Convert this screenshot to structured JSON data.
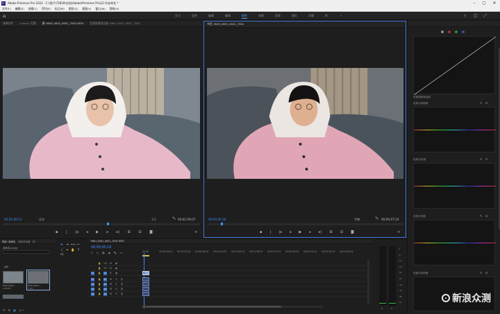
{
  "titlebar": {
    "title": "Adobe Premiere Pro 2022 - C:\\用户\\75839\\文档\\Adobe\\Premiere Pro\\22.0\\未命名 *",
    "logo": "Pr",
    "min": "–",
    "max": "▢",
    "close": "✕"
  },
  "menu": [
    "文件(F)",
    "编辑(E)",
    "剪辑(C)",
    "序列(S)",
    "标记(M)",
    "图形(G)",
    "视图(V)",
    "窗口(W)",
    "帮助(H)"
  ],
  "workspaces": [
    {
      "label": "学习",
      "active": false
    },
    {
      "label": "组件",
      "active": false
    },
    {
      "label": "编辑",
      "active": false
    },
    {
      "label": "颜色",
      "active": true
    },
    {
      "label": "效果",
      "active": false
    },
    {
      "label": "音频",
      "active": false
    },
    {
      "label": "图形",
      "active": false
    },
    {
      "label": "字幕",
      "active": false
    },
    {
      "label": "库",
      "active": false
    }
  ],
  "source_panel": {
    "tabs": [
      "效果控件",
      "Lumetri 范围",
      "源: MAH_0001_0001_7001.MOV",
      "音频剪辑混合器: MAH_0001_0001_7001"
    ],
    "timecode": "00;01;09;11",
    "fit": "适合",
    "scale": "1/2",
    "duration": "00;01;09;07"
  },
  "program_panel": {
    "tab": "节目: MAH_0001_0001_7001",
    "timecode": "00;00;00;18",
    "fit": "完整",
    "duration": "00;00;07;24"
  },
  "lumetri": {
    "wheel_label": "色相饱和度曲线",
    "sections": [
      "色相与饱和度",
      "色相与色相",
      "色相与亮度",
      "亮度与饱和度"
    ]
  },
  "project_panel": {
    "tabs": [
      "项目: 未命名",
      "媒体浏览器",
      "库"
    ],
    "subtitle": "未命名.prproj",
    "search_placeholder": "",
    "clips": [
      {
        "name": "MAH_0001...",
        "duration": "1:09:07"
      },
      {
        "name": "MAH_0001...",
        "duration": "7:24"
      }
    ]
  },
  "timeline": {
    "tab": "MAH_0001_0001_7001.MOV",
    "timecode": "00;00;00;18",
    "ruler": [
      "00;00",
      "00;00;16;00",
      "00;00;32;00",
      "00;00;48;00",
      "00;01;04;02",
      "00;01;20;02",
      "00;01;36;02",
      "00;01;52;04",
      "00;02;08;04",
      "00;02;24;04",
      "00;02;40;04",
      "00;02;56;04"
    ],
    "tracks": [
      "V3",
      "V2",
      "V1",
      "A1",
      "A2",
      "A3",
      "A4"
    ],
    "clip_label": "fx"
  },
  "meters": {
    "scale": [
      "0",
      "-6",
      "-12",
      "-18",
      "-24",
      "-30",
      "-36",
      "-42",
      "-48",
      "-54"
    ],
    "bottom": [
      "S",
      "S"
    ]
  },
  "watermark": "新浪众测",
  "colors": {
    "accent": "#3f8fff",
    "panel_border": "#3b7ad6"
  }
}
